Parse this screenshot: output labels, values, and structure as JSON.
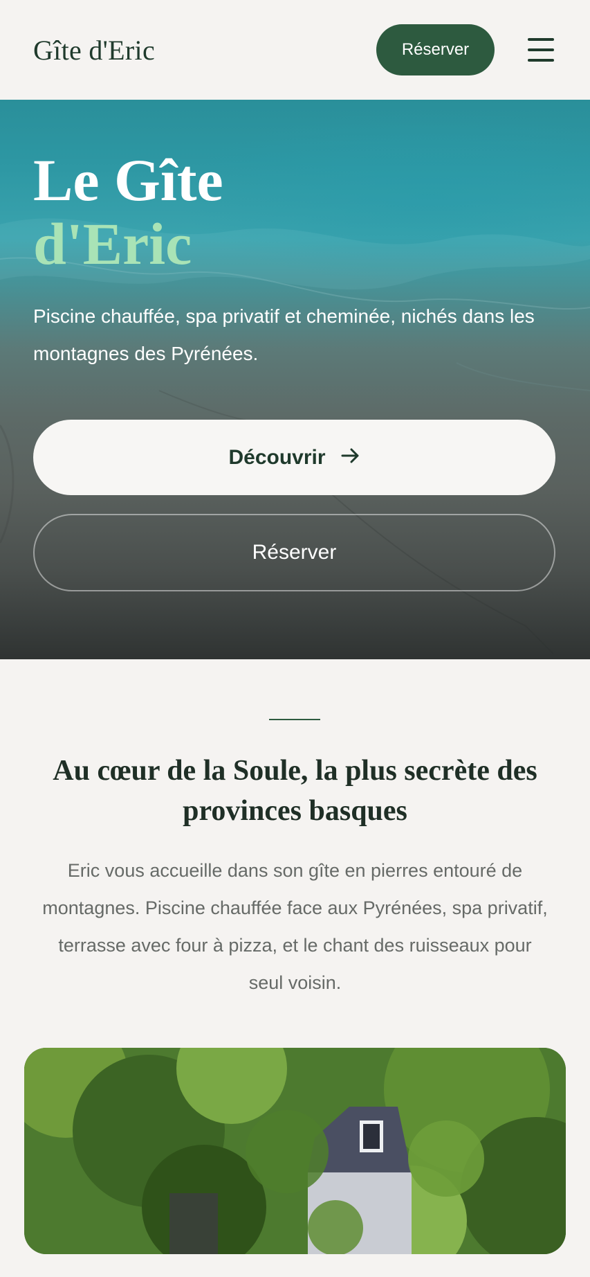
{
  "header": {
    "logo": "Gîte d'Eric",
    "reserve_label": "Réserver",
    "menu_icon": "hamburger-menu-icon"
  },
  "hero": {
    "title_line1": "Le Gîte",
    "title_line2": "d'Eric",
    "subtitle": "Piscine chauffée, spa privatif et cheminée, nichés dans les montagnes des Pyrénées.",
    "discover_label": "Découvrir",
    "discover_icon": "arrow-right-icon",
    "reserve_label": "Réserver"
  },
  "intro": {
    "title": "Au cœur de la Soule, la plus secrète des provinces basques",
    "text": "Eric vous accueille dans son gîte en pierres entouré de montagnes. Piscine chauffée face aux Pyrénées, spa privatif, terrasse avec four à pizza, et le chant des ruisseaux pour seul voisin."
  },
  "colors": {
    "brand_green": "#2d5a3f",
    "accent_mint": "#a9e3b6",
    "background": "#f5f3f1"
  }
}
